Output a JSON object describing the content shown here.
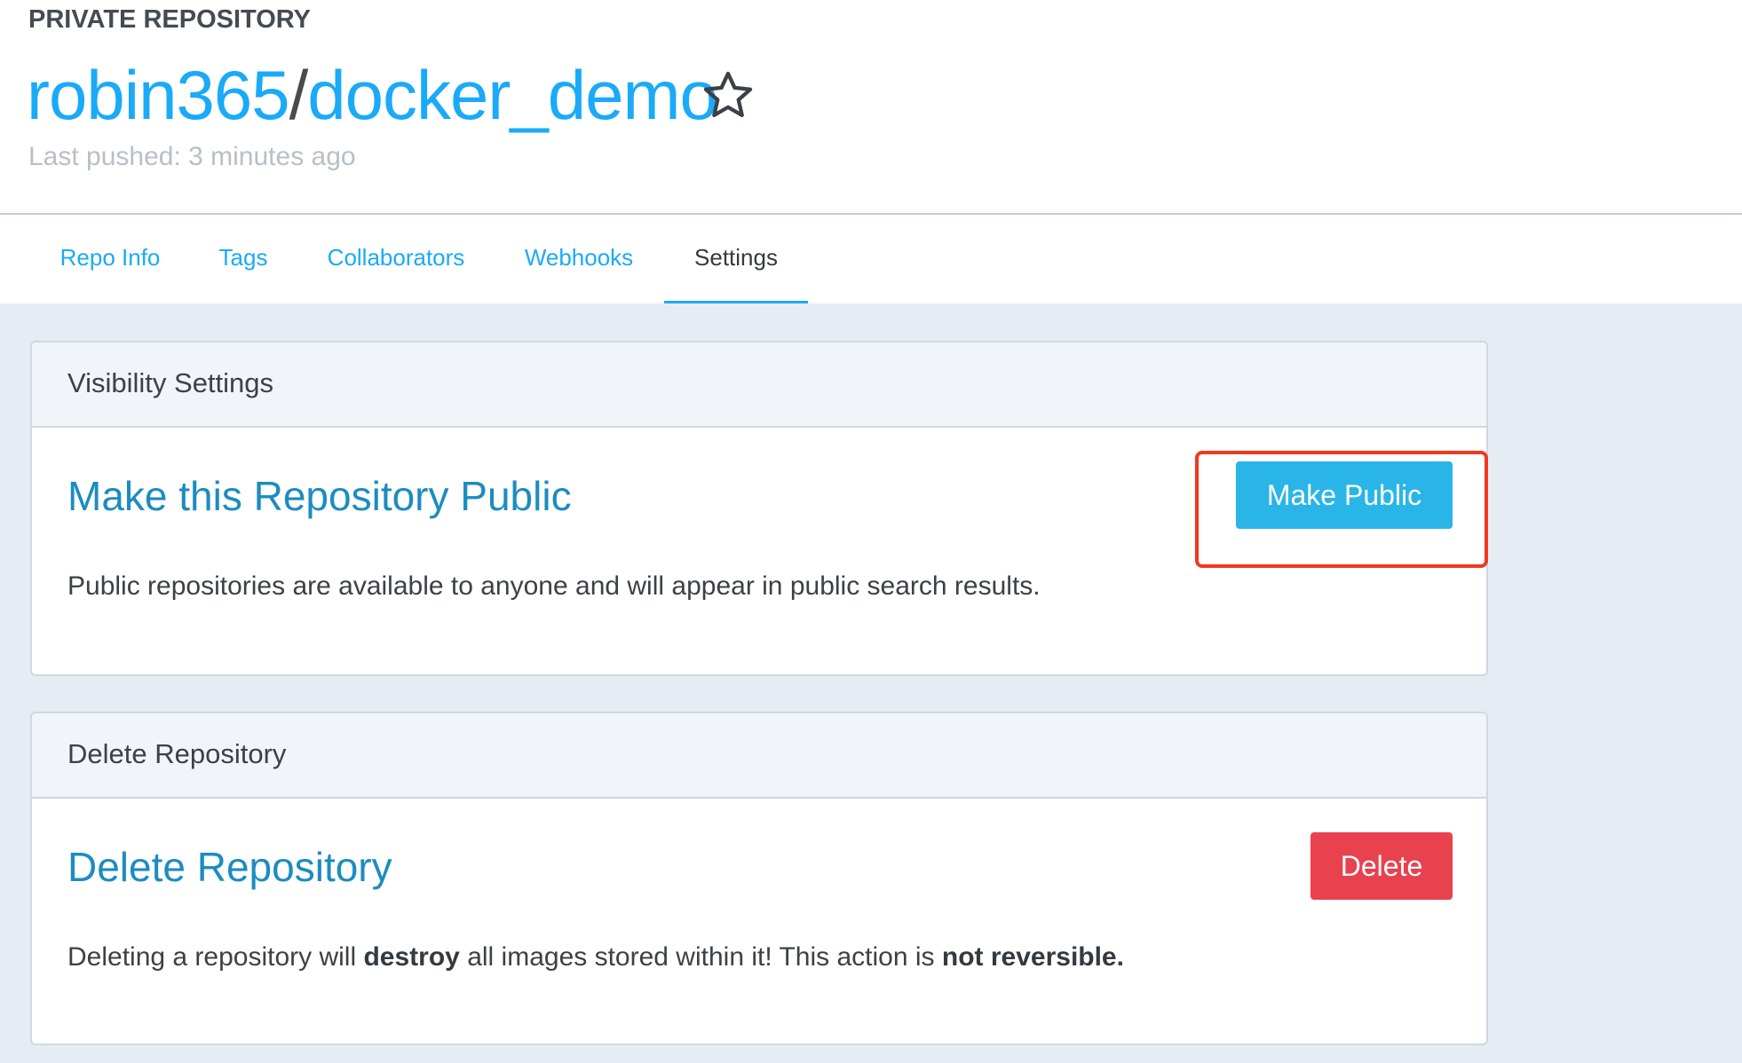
{
  "header": {
    "visibility_label": "PRIVATE REPOSITORY",
    "repo_owner": "robin365",
    "separator": "/",
    "repo_name": "docker_demo",
    "star_icon": "star-outline-icon",
    "last_pushed": "Last pushed: 3 minutes ago"
  },
  "tabs": [
    {
      "label": "Repo Info",
      "active": false
    },
    {
      "label": "Tags",
      "active": false
    },
    {
      "label": "Collaborators",
      "active": false
    },
    {
      "label": "Webhooks",
      "active": false
    },
    {
      "label": "Settings",
      "active": true
    }
  ],
  "visibility_card": {
    "header": "Visibility Settings",
    "title": "Make this Repository Public",
    "description": "Public repositories are available to anyone and will appear in public search results.",
    "button_label": "Make Public"
  },
  "delete_card": {
    "header": "Delete Repository",
    "title": "Delete Repository",
    "description_parts": {
      "p1": "Deleting a repository will ",
      "b1": "destroy",
      "p2": " all images stored within it! This action is ",
      "b2": "not reversible."
    },
    "button_label": "Delete"
  },
  "colors": {
    "link_blue": "#1aaaf8",
    "primary_button": "#29b5e8",
    "danger_button": "#e8424e",
    "highlight_red": "#f0391e",
    "page_background": "#e6ecf3"
  }
}
